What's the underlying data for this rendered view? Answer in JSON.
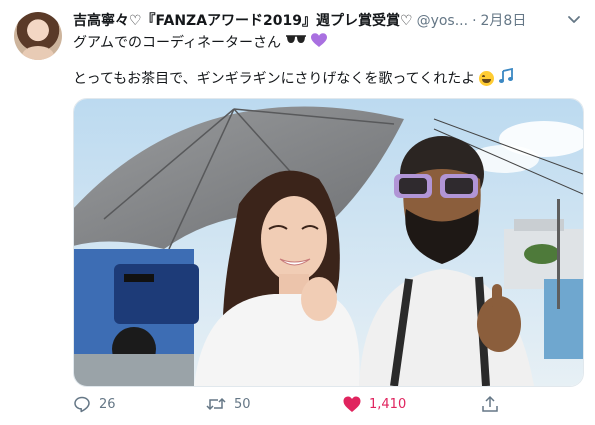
{
  "tweet": {
    "display_name": "吉高寧々♡『FANZAアワード2019』週プレ賞受賞♡",
    "handle": "@yos...",
    "separator": "·",
    "timestamp": "2月8日",
    "location_line": "グアムでのコーディネーターさん",
    "body": "とってもお茶目で、ギンギラギンにさりげなくを歌ってくれたよ",
    "emojis": [
      "sunglasses-icon",
      "purple-heart-icon",
      "grinning-squinting-face-icon",
      "musical-notes-icon"
    ]
  },
  "actions": {
    "reply_count": "26",
    "retweet_count": "50",
    "like_count": "1,410"
  },
  "colors": {
    "like_active": "#e0245e",
    "muted": "#657786",
    "purple_heart": "#a970e0"
  }
}
